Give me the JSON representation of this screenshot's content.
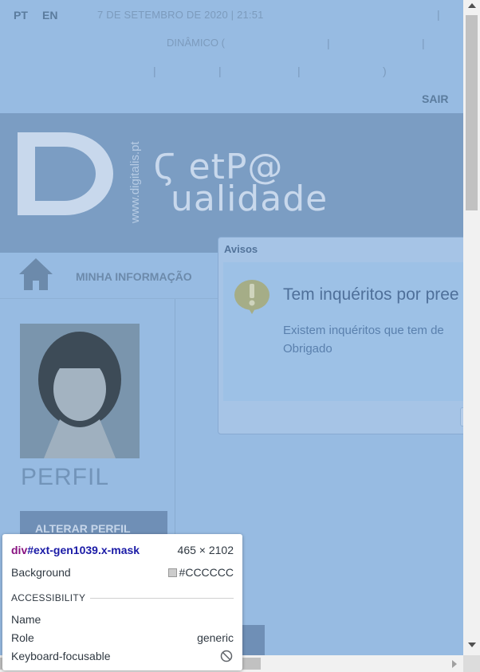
{
  "topbar": {
    "lang_pt": "PT",
    "lang_en": "EN",
    "datetime": "7 DE SETEMBRO DE 2020 | 21:51",
    "dinamico": "DINÂMICO (",
    "pipe": "|",
    "paren_close": ")",
    "sair": "SAIR"
  },
  "banner": {
    "vertical_text": "www.digitalis.pt",
    "brand_line1": "Ϛ etP@",
    "brand_line2": "ualidade"
  },
  "nav": {
    "minha_informacao": "MINHA INFORMAÇÃO"
  },
  "sidebar": {
    "perfil_heading": "PERFIL",
    "alterar_perfil": "ALTERAR PERFIL"
  },
  "dialog": {
    "title": "Avisos",
    "heading": "Tem inquéritos por pree",
    "message_line1": "Existem inquéritos que tem de",
    "message_line2": "Obrigado"
  },
  "tooltip": {
    "tag": "div",
    "selector": "#ext-gen1039.x-mask",
    "size": "465 × 2102",
    "background_label": "Background",
    "background_value": "#CCCCCC",
    "section": "ACCESSIBILITY",
    "name_label": "Name",
    "role_label": "Role",
    "role_value": "generic",
    "focusable_label": "Keyboard-focusable"
  },
  "colors": {
    "mask_tint": "#97bbe2",
    "swatch": "#CCCCCC"
  }
}
